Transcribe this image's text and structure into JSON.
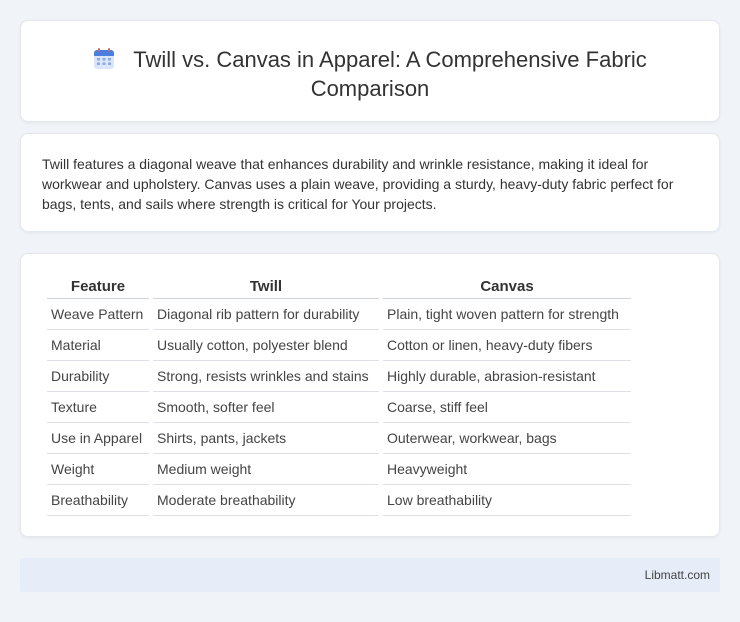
{
  "header": {
    "icon": "calendar-icon",
    "title": "Twill vs. Canvas in Apparel: A Comprehensive Fabric Comparison"
  },
  "summary": {
    "text": "Twill features a diagonal weave that enhances durability and wrinkle resistance, making it ideal for workwear and upholstery. Canvas uses a plain weave, providing a sturdy, heavy-duty fabric perfect for bags, tents, and sails where strength is critical for Your projects."
  },
  "table": {
    "headers": [
      "Feature",
      "Twill",
      "Canvas"
    ],
    "rows": [
      [
        "Weave Pattern",
        "Diagonal rib pattern for durability",
        "Plain, tight woven pattern for strength"
      ],
      [
        "Material",
        "Usually cotton, polyester blend",
        "Cotton or linen, heavy-duty fibers"
      ],
      [
        "Durability",
        "Strong, resists wrinkles and stains",
        "Highly durable, abrasion-resistant"
      ],
      [
        "Texture",
        "Smooth, softer feel",
        "Coarse, stiff feel"
      ],
      [
        "Use in Apparel",
        "Shirts, pants, jackets",
        "Outerwear, workwear, bags"
      ],
      [
        "Weight",
        "Medium weight",
        "Heavyweight"
      ],
      [
        "Breathability",
        "Moderate breathability",
        "Low breathability"
      ]
    ]
  },
  "footer": {
    "site": "Libmatt.com"
  }
}
